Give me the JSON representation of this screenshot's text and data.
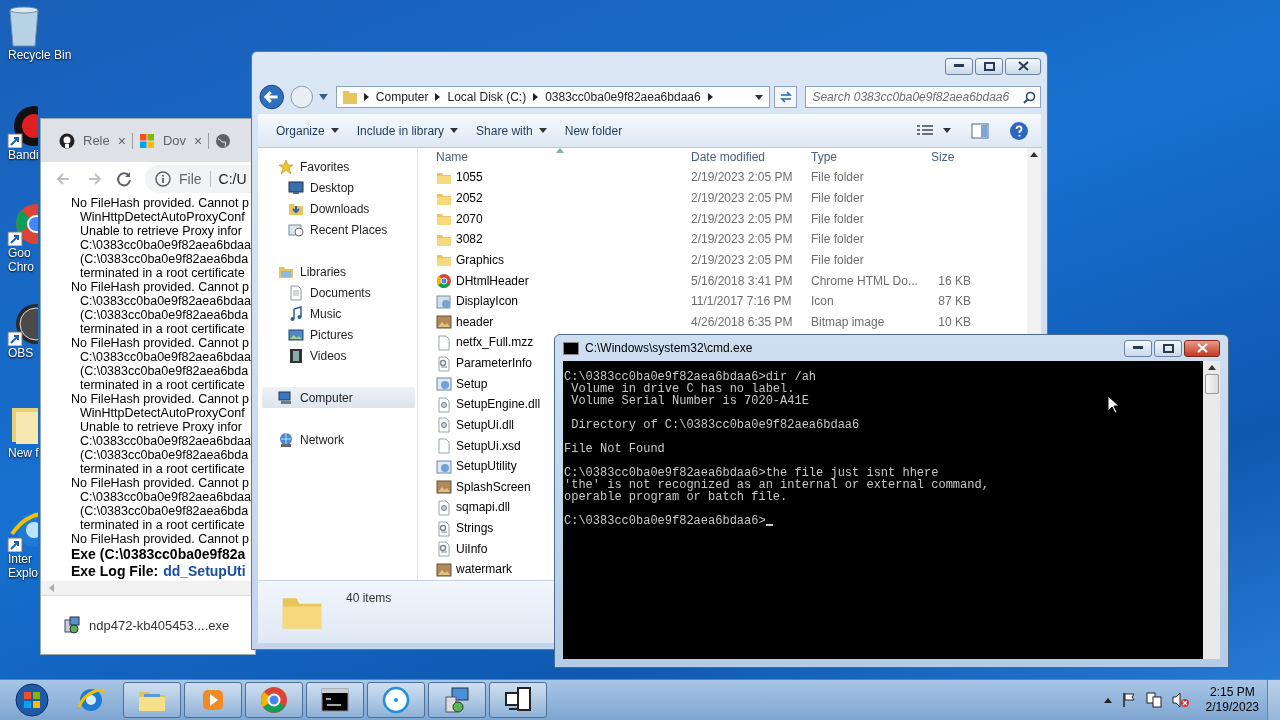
{
  "desktop_icons": [
    {
      "kind": "recycle-bin",
      "label_lines": [
        "Recycle Bin"
      ]
    },
    {
      "kind": "recorder",
      "label_lines": [
        "Bandi"
      ]
    },
    {
      "kind": "chrome",
      "label_lines": [
        "Goo",
        "Chro"
      ]
    },
    {
      "kind": "obs",
      "label_lines": [
        "OBS"
      ]
    },
    {
      "kind": "folder",
      "label_lines": [
        "New f"
      ]
    },
    {
      "kind": "ie",
      "label_lines": [
        "Inter",
        "Explo"
      ]
    }
  ],
  "browser": {
    "tabs": [
      {
        "kind": "github",
        "title": "Rele",
        "close": "×"
      },
      {
        "kind": "windows",
        "title": "Dov",
        "close": "×"
      },
      {
        "kind": "globe"
      }
    ],
    "nav": [
      {
        "kind": "back",
        "disabled": true
      },
      {
        "kind": "forward",
        "disabled": true
      },
      {
        "kind": "reload",
        "disabled": false
      }
    ],
    "address": {
      "scheme": "File",
      "url": "C:/U"
    },
    "log_lines": [
      {
        "kind": "entry",
        "text": "No FileHash provided. Cannot p"
      },
      {
        "kind": "detail",
        "text": "WinHttpDetectAutoProxyConf"
      },
      {
        "kind": "detail",
        "text": "Unable to retrieve Proxy infor"
      },
      {
        "kind": "detail",
        "text": "C:\\0383cc0ba0e9f82aea6bdaa"
      },
      {
        "kind": "detail",
        "text": "(C:\\0383cc0ba0e9f82aea6bda"
      },
      {
        "kind": "detail",
        "text": "terminated in a root certificate"
      },
      {
        "kind": "entry",
        "text": "No FileHash provided. Cannot p"
      },
      {
        "kind": "detail",
        "text": "C:\\0383cc0ba0e9f82aea6bdaa"
      },
      {
        "kind": "detail",
        "text": "(C:\\0383cc0ba0e9f82aea6bda"
      },
      {
        "kind": "detail",
        "text": "terminated in a root certificate"
      },
      {
        "kind": "entry",
        "text": "No FileHash provided. Cannot p"
      },
      {
        "kind": "detail",
        "text": "C:\\0383cc0ba0e9f82aea6bdaa"
      },
      {
        "kind": "detail",
        "text": "(C:\\0383cc0ba0e9f82aea6bda"
      },
      {
        "kind": "detail",
        "text": "terminated in a root certificate"
      },
      {
        "kind": "entry",
        "text": "No FileHash provided. Cannot p"
      },
      {
        "kind": "detail",
        "text": "WinHttpDetectAutoProxyConf"
      },
      {
        "kind": "detail",
        "text": "Unable to retrieve Proxy infor"
      },
      {
        "kind": "detail",
        "text": "C:\\0383cc0ba0e9f82aea6bdaa"
      },
      {
        "kind": "detail",
        "text": "(C:\\0383cc0ba0e9f82aea6bda"
      },
      {
        "kind": "detail",
        "text": "terminated in a root certificate"
      },
      {
        "kind": "entry",
        "text": "No FileHash provided. Cannot p"
      },
      {
        "kind": "detail",
        "text": "C:\\0383cc0ba0e9f82aea6bdaa"
      },
      {
        "kind": "detail",
        "text": "(C:\\0383cc0ba0e9f82aea6bda"
      },
      {
        "kind": "detail",
        "text": "terminated in a root certificate"
      },
      {
        "kind": "entry",
        "text": "No FileHash provided. Cannot p"
      },
      {
        "kind": "summary",
        "text": "Exe (C:\\0383cc0ba0e9f82a"
      },
      {
        "kind": "log-file",
        "text": "Exe Log File:",
        "link": "dd_SetupUti"
      }
    ],
    "download": {
      "file": "ndp472-kb405453....exe"
    }
  },
  "explorer": {
    "breadcrumbs": [
      "Computer",
      "Local Disk (C:)",
      "0383cc0ba0e9f82aea6bdaa6"
    ],
    "search": {
      "placeholder": "Search 0383cc0ba0e9f82aea6bdaa6"
    },
    "toolbar": [
      {
        "label": "Organize",
        "dropdown": true
      },
      {
        "label": "Include in library",
        "dropdown": true
      },
      {
        "label": "Share with",
        "dropdown": true
      },
      {
        "label": "New folder",
        "dropdown": false
      }
    ],
    "nav_tree": [
      {
        "kind": "star",
        "label": "Favorites",
        "selected": false,
        "children": [
          {
            "kind": "desktop",
            "label": "Desktop",
            "selected": false
          },
          {
            "kind": "downloads",
            "label": "Downloads",
            "selected": false
          },
          {
            "kind": "recent",
            "label": "Recent Places",
            "selected": false
          }
        ]
      },
      {
        "kind": "library",
        "label": "Libraries",
        "selected": false,
        "children": [
          {
            "kind": "documents",
            "label": "Documents",
            "selected": false
          },
          {
            "kind": "music",
            "label": "Music",
            "selected": false
          },
          {
            "kind": "pictures",
            "label": "Pictures",
            "selected": false
          },
          {
            "kind": "videos",
            "label": "Videos",
            "selected": false
          }
        ]
      },
      {
        "kind": "computer",
        "label": "Computer",
        "selected": true
      },
      {
        "kind": "network",
        "label": "Network",
        "selected": false
      }
    ],
    "columns": [
      "Name",
      "Date modified",
      "Type",
      "Size"
    ],
    "files": [
      {
        "kind": "folder",
        "name": "1055",
        "date": "2/19/2023 2:05 PM",
        "type": "File folder"
      },
      {
        "kind": "folder",
        "name": "2052",
        "date": "2/19/2023 2:05 PM",
        "type": "File folder"
      },
      {
        "kind": "folder",
        "name": "2070",
        "date": "2/19/2023 2:05 PM",
        "type": "File folder"
      },
      {
        "kind": "folder",
        "name": "3082",
        "date": "2/19/2023 2:05 PM",
        "type": "File folder"
      },
      {
        "kind": "folder",
        "name": "Graphics",
        "date": "2/19/2023 2:05 PM",
        "type": "File folder"
      },
      {
        "kind": "html",
        "name": "DHtmlHeader",
        "date": "5/16/2018 3:41 PM",
        "type": "Chrome HTML Do...",
        "size": "16 KB"
      },
      {
        "kind": "icon",
        "name": "DisplayIcon",
        "date": "11/1/2017 7:16 PM",
        "type": "Icon",
        "size": "87 KB"
      },
      {
        "kind": "bitmap",
        "name": "header",
        "date": "4/26/2018 6:35 PM",
        "type": "Bitmap image",
        "size": "10 KB"
      },
      {
        "kind": "blank",
        "name": "netfx_Full.mzz"
      },
      {
        "kind": "settings",
        "name": "ParameterInfo"
      },
      {
        "kind": "app",
        "name": "Setup"
      },
      {
        "kind": "dll",
        "name": "SetupEngine.dll"
      },
      {
        "kind": "dll",
        "name": "SetupUi.dll"
      },
      {
        "kind": "blank",
        "name": "SetupUi.xsd"
      },
      {
        "kind": "app",
        "name": "SetupUtility"
      },
      {
        "kind": "bitmap",
        "name": "SplashScreen"
      },
      {
        "kind": "dll",
        "name": "sqmapi.dll"
      },
      {
        "kind": "settings",
        "name": "Strings"
      },
      {
        "kind": "settings",
        "name": "UiInfo"
      },
      {
        "kind": "bitmap",
        "name": "watermark"
      }
    ],
    "status": "40 items"
  },
  "cmd": {
    "title": "C:\\Windows\\system32\\cmd.exe",
    "blocks": [
      [
        "C:\\0383cc0ba0e9f82aea6bdaa6>dir /ah",
        " Volume in drive C has no label.",
        " Volume Serial Number is 7020-A41E"
      ],
      [
        " Directory of C:\\0383cc0ba0e9f82aea6bdaa6"
      ],
      [
        "File Not Found"
      ],
      [
        "C:\\0383cc0ba0e9f82aea6bdaa6>the file just isnt hhere",
        "'the' is not recognized as an internal or external command,",
        "operable program or batch file."
      ],
      [
        "C:\\0383cc0ba0e9f82aea6bdaa6>"
      ]
    ]
  },
  "taskbar": {
    "apps": [
      {
        "kind": "ie",
        "running": false
      },
      {
        "kind": "explorer",
        "running": true
      },
      {
        "kind": "media",
        "running": true
      },
      {
        "kind": "chrome",
        "running": true
      },
      {
        "kind": "cmd",
        "running": true
      },
      {
        "kind": "circle",
        "running": true
      },
      {
        "kind": "setup",
        "running": true
      },
      {
        "kind": "computer",
        "running": true
      }
    ],
    "clock": {
      "time": "2:15 PM",
      "date": "2/19/2023"
    }
  }
}
